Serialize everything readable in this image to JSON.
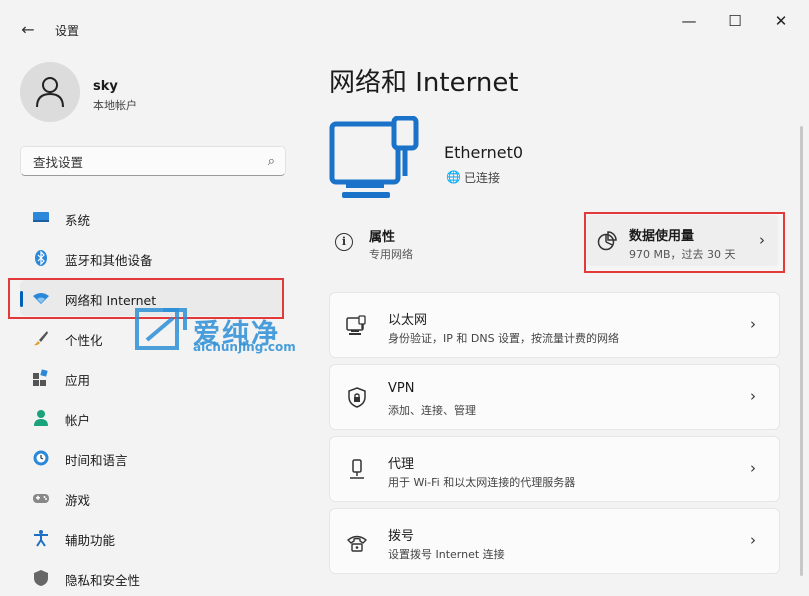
{
  "window": {
    "title": "设置",
    "back": "←",
    "minimize": "—",
    "maximize": "☐",
    "close": "✕"
  },
  "profile": {
    "name": "sky",
    "account_type": "本地帐户"
  },
  "search": {
    "placeholder": "查找设置"
  },
  "sidebar": {
    "items": [
      {
        "label": "系统",
        "icon": "monitor-icon"
      },
      {
        "label": "蓝牙和其他设备",
        "icon": "bluetooth-icon"
      },
      {
        "label": "网络和 Internet",
        "icon": "wifi-icon",
        "active": true
      },
      {
        "label": "个性化",
        "icon": "brush-icon"
      },
      {
        "label": "应用",
        "icon": "apps-icon"
      },
      {
        "label": "帐户",
        "icon": "person-icon"
      },
      {
        "label": "时间和语言",
        "icon": "globe-clock-icon"
      },
      {
        "label": "游戏",
        "icon": "gamepad-icon"
      },
      {
        "label": "辅助功能",
        "icon": "accessibility-icon"
      },
      {
        "label": "隐私和安全性",
        "icon": "shield-icon"
      }
    ]
  },
  "main": {
    "title": "网络和 Internet",
    "adapter": {
      "name": "Ethernet0",
      "status": "已连接"
    },
    "properties": {
      "title": "属性",
      "subtitle": "专用网络"
    },
    "data_usage": {
      "title": "数据使用量",
      "subtitle": "970 MB，过去 30 天"
    },
    "cards": [
      {
        "title": "以太网",
        "subtitle": "身份验证，IP 和 DNS 设置，按流量计费的网络",
        "icon": "ethernet-icon"
      },
      {
        "title": "VPN",
        "subtitle": "添加、连接、管理",
        "icon": "vpn-shield-icon"
      },
      {
        "title": "代理",
        "subtitle": "用于 Wi-Fi 和以太网连接的代理服务器",
        "icon": "proxy-icon"
      },
      {
        "title": "拨号",
        "subtitle": "设置拨号 Internet 连接",
        "icon": "dialup-icon"
      }
    ]
  },
  "watermark": {
    "text": "爱纯净",
    "url": "aichunjing.com"
  },
  "colors": {
    "accent": "#005fb8",
    "highlight": "#e23a3a",
    "watermark": "#2b8fd6"
  }
}
